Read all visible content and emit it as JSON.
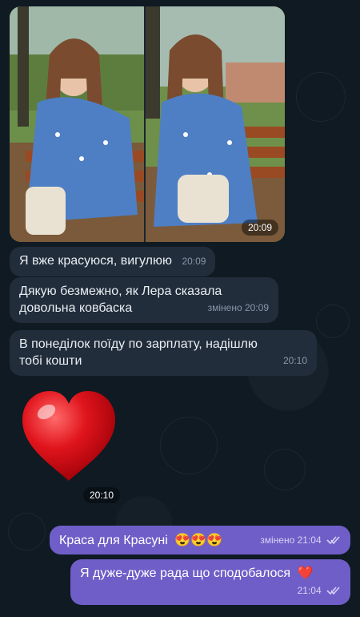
{
  "album": {
    "time": "20:09"
  },
  "messages_in": [
    {
      "text": "Я вже красуюся, вигулюю",
      "meta": "20:09"
    },
    {
      "line1": "Дякую безмежно, як Лера сказала",
      "line2": "довольна ковбаска",
      "meta": "змінено 20:09"
    },
    {
      "line1": "В понеділок поїду по зарплату, надішлю",
      "line2": "тобі кошти",
      "meta": "20:10"
    }
  ],
  "heart_sticker": {
    "time": "20:10"
  },
  "messages_out": [
    {
      "text": "Краса для Красуні",
      "emoji": "😍😍😍",
      "meta": "змінено 21:04"
    },
    {
      "text": "Я дуже-дуже рада що сподобалося",
      "emoji": "❤️",
      "meta": "21:04"
    }
  ],
  "colors": {
    "background": "#0f1a22",
    "incoming_bubble": "#212d3b",
    "outgoing_bubble": "#6f5ec7",
    "heart": "#e0141c"
  }
}
